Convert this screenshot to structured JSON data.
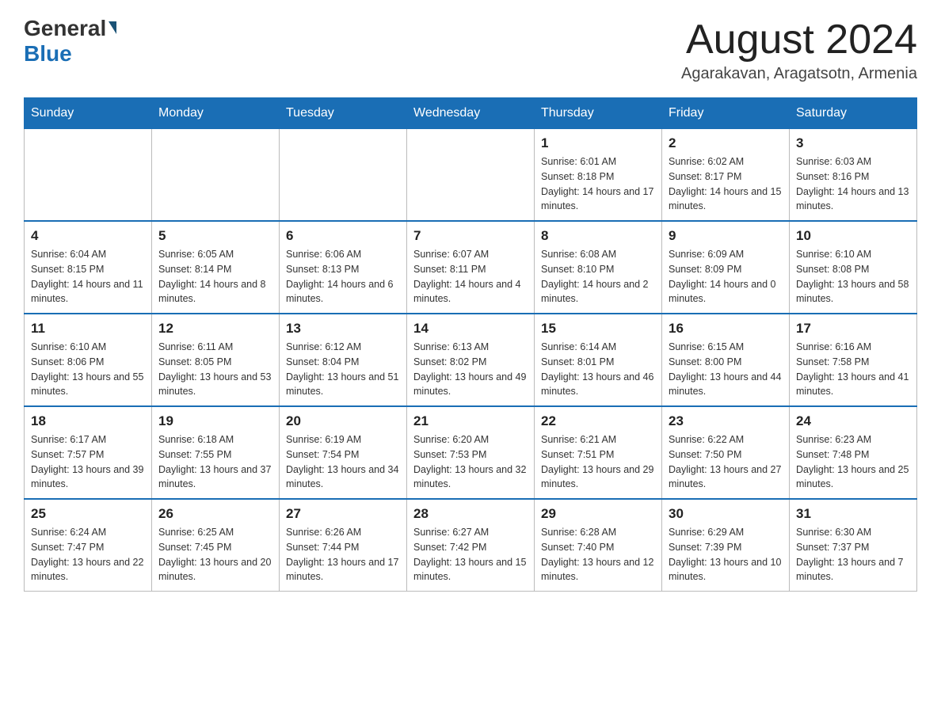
{
  "header": {
    "logo_general": "General",
    "logo_blue": "Blue",
    "month_title": "August 2024",
    "location": "Agarakavan, Aragatsotn, Armenia"
  },
  "days_of_week": [
    "Sunday",
    "Monday",
    "Tuesday",
    "Wednesday",
    "Thursday",
    "Friday",
    "Saturday"
  ],
  "weeks": [
    [
      {
        "day": "",
        "info": ""
      },
      {
        "day": "",
        "info": ""
      },
      {
        "day": "",
        "info": ""
      },
      {
        "day": "",
        "info": ""
      },
      {
        "day": "1",
        "info": "Sunrise: 6:01 AM\nSunset: 8:18 PM\nDaylight: 14 hours and 17 minutes."
      },
      {
        "day": "2",
        "info": "Sunrise: 6:02 AM\nSunset: 8:17 PM\nDaylight: 14 hours and 15 minutes."
      },
      {
        "day": "3",
        "info": "Sunrise: 6:03 AM\nSunset: 8:16 PM\nDaylight: 14 hours and 13 minutes."
      }
    ],
    [
      {
        "day": "4",
        "info": "Sunrise: 6:04 AM\nSunset: 8:15 PM\nDaylight: 14 hours and 11 minutes."
      },
      {
        "day": "5",
        "info": "Sunrise: 6:05 AM\nSunset: 8:14 PM\nDaylight: 14 hours and 8 minutes."
      },
      {
        "day": "6",
        "info": "Sunrise: 6:06 AM\nSunset: 8:13 PM\nDaylight: 14 hours and 6 minutes."
      },
      {
        "day": "7",
        "info": "Sunrise: 6:07 AM\nSunset: 8:11 PM\nDaylight: 14 hours and 4 minutes."
      },
      {
        "day": "8",
        "info": "Sunrise: 6:08 AM\nSunset: 8:10 PM\nDaylight: 14 hours and 2 minutes."
      },
      {
        "day": "9",
        "info": "Sunrise: 6:09 AM\nSunset: 8:09 PM\nDaylight: 14 hours and 0 minutes."
      },
      {
        "day": "10",
        "info": "Sunrise: 6:10 AM\nSunset: 8:08 PM\nDaylight: 13 hours and 58 minutes."
      }
    ],
    [
      {
        "day": "11",
        "info": "Sunrise: 6:10 AM\nSunset: 8:06 PM\nDaylight: 13 hours and 55 minutes."
      },
      {
        "day": "12",
        "info": "Sunrise: 6:11 AM\nSunset: 8:05 PM\nDaylight: 13 hours and 53 minutes."
      },
      {
        "day": "13",
        "info": "Sunrise: 6:12 AM\nSunset: 8:04 PM\nDaylight: 13 hours and 51 minutes."
      },
      {
        "day": "14",
        "info": "Sunrise: 6:13 AM\nSunset: 8:02 PM\nDaylight: 13 hours and 49 minutes."
      },
      {
        "day": "15",
        "info": "Sunrise: 6:14 AM\nSunset: 8:01 PM\nDaylight: 13 hours and 46 minutes."
      },
      {
        "day": "16",
        "info": "Sunrise: 6:15 AM\nSunset: 8:00 PM\nDaylight: 13 hours and 44 minutes."
      },
      {
        "day": "17",
        "info": "Sunrise: 6:16 AM\nSunset: 7:58 PM\nDaylight: 13 hours and 41 minutes."
      }
    ],
    [
      {
        "day": "18",
        "info": "Sunrise: 6:17 AM\nSunset: 7:57 PM\nDaylight: 13 hours and 39 minutes."
      },
      {
        "day": "19",
        "info": "Sunrise: 6:18 AM\nSunset: 7:55 PM\nDaylight: 13 hours and 37 minutes."
      },
      {
        "day": "20",
        "info": "Sunrise: 6:19 AM\nSunset: 7:54 PM\nDaylight: 13 hours and 34 minutes."
      },
      {
        "day": "21",
        "info": "Sunrise: 6:20 AM\nSunset: 7:53 PM\nDaylight: 13 hours and 32 minutes."
      },
      {
        "day": "22",
        "info": "Sunrise: 6:21 AM\nSunset: 7:51 PM\nDaylight: 13 hours and 29 minutes."
      },
      {
        "day": "23",
        "info": "Sunrise: 6:22 AM\nSunset: 7:50 PM\nDaylight: 13 hours and 27 minutes."
      },
      {
        "day": "24",
        "info": "Sunrise: 6:23 AM\nSunset: 7:48 PM\nDaylight: 13 hours and 25 minutes."
      }
    ],
    [
      {
        "day": "25",
        "info": "Sunrise: 6:24 AM\nSunset: 7:47 PM\nDaylight: 13 hours and 22 minutes."
      },
      {
        "day": "26",
        "info": "Sunrise: 6:25 AM\nSunset: 7:45 PM\nDaylight: 13 hours and 20 minutes."
      },
      {
        "day": "27",
        "info": "Sunrise: 6:26 AM\nSunset: 7:44 PM\nDaylight: 13 hours and 17 minutes."
      },
      {
        "day": "28",
        "info": "Sunrise: 6:27 AM\nSunset: 7:42 PM\nDaylight: 13 hours and 15 minutes."
      },
      {
        "day": "29",
        "info": "Sunrise: 6:28 AM\nSunset: 7:40 PM\nDaylight: 13 hours and 12 minutes."
      },
      {
        "day": "30",
        "info": "Sunrise: 6:29 AM\nSunset: 7:39 PM\nDaylight: 13 hours and 10 minutes."
      },
      {
        "day": "31",
        "info": "Sunrise: 6:30 AM\nSunset: 7:37 PM\nDaylight: 13 hours and 7 minutes."
      }
    ]
  ]
}
